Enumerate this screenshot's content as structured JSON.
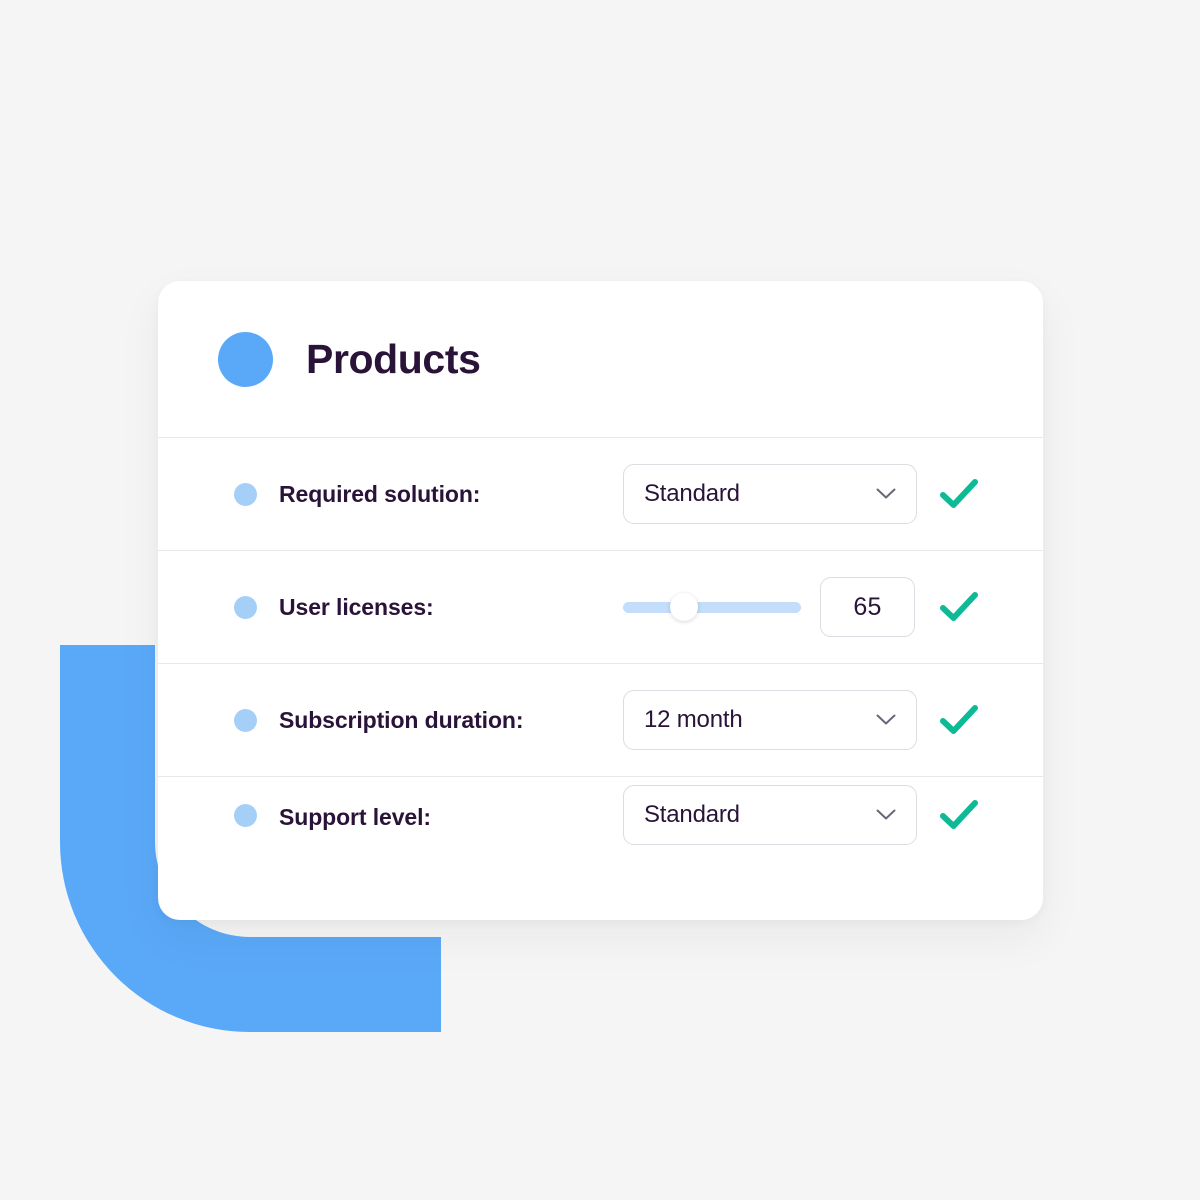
{
  "background_color": "#f5f5f5",
  "decoration": {
    "name": "blue-l-hook",
    "color": "#5aa9f8"
  },
  "card": {
    "background_color": "#ffffff",
    "header": {
      "title": "Products",
      "dot_color": "#5aa9f8",
      "title_color": "#2a1338"
    },
    "accent_colors": {
      "bullet": "#a6cff8",
      "check": "#0dba96",
      "slider_track": "#c3ddfb",
      "border": "#dcdce2"
    },
    "rows": [
      {
        "label": "Required solution:",
        "control_type": "select",
        "value": "Standard",
        "icon": "chevron-down-icon",
        "status_icon": "check-icon"
      },
      {
        "label": "User licenses:",
        "control_type": "slider",
        "value": "65",
        "slider_percent": 34,
        "status_icon": "check-icon"
      },
      {
        "label": "Subscription duration:",
        "control_type": "select",
        "value": "12 month",
        "icon": "chevron-down-icon",
        "status_icon": "check-icon"
      },
      {
        "label": "Support level:",
        "control_type": "select",
        "value": "Standard",
        "icon": "chevron-down-icon",
        "status_icon": "check-icon"
      }
    ]
  }
}
